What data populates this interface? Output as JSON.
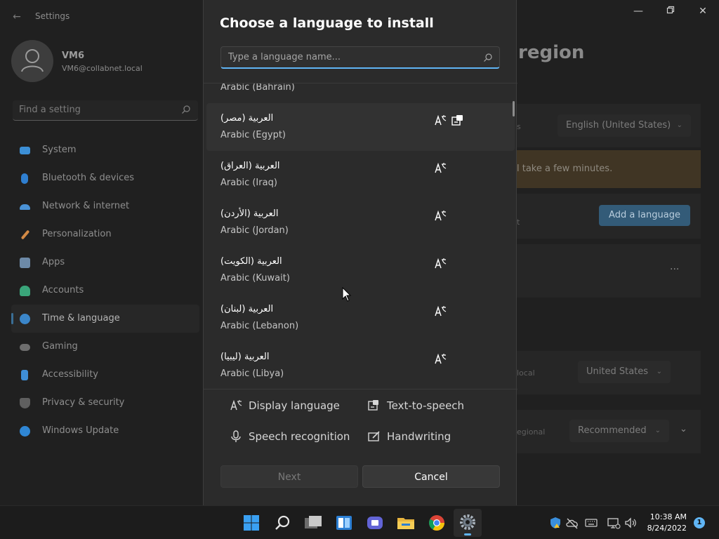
{
  "settings_window": {
    "app_title": "Settings",
    "user": {
      "name": "VM6",
      "email": "VM6@collabnet.local"
    },
    "search_placeholder": "Find a setting",
    "nav_items": [
      {
        "label": "System",
        "icon": "monitor-icon",
        "color": "#3c8fd6"
      },
      {
        "label": "Bluetooth & devices",
        "icon": "bluetooth-icon",
        "color": "#2f7fd0"
      },
      {
        "label": "Network & internet",
        "icon": "wifi-icon",
        "color": "#4a92d6"
      },
      {
        "label": "Personalization",
        "icon": "brush-icon",
        "color": "#d38a45"
      },
      {
        "label": "Apps",
        "icon": "apps-icon",
        "color": "#6d8aa8"
      },
      {
        "label": "Accounts",
        "icon": "person-icon",
        "color": "#3aa57a"
      },
      {
        "label": "Time & language",
        "icon": "globe-clock-icon",
        "color": "#3b86c9"
      },
      {
        "label": "Gaming",
        "icon": "gamepad-icon",
        "color": "#8a8a8a"
      },
      {
        "label": "Accessibility",
        "icon": "accessibility-icon",
        "color": "#3f8fd8"
      },
      {
        "label": "Privacy & security",
        "icon": "shield-icon",
        "color": "#6f6f6f"
      },
      {
        "label": "Windows Update",
        "icon": "update-icon",
        "color": "#2f86d4"
      }
    ],
    "active_nav": "Time & language",
    "page_header_partial": "region",
    "windows_display_language": "English (United States)",
    "notice_partial": "l take a few minutes.",
    "add_language_button": "Add a language",
    "ellipsis": "···",
    "country_label_partial": "local",
    "country_value": "United States",
    "regional_label_partial": "egional",
    "regional_value": "Recommended",
    "status_partial_s": "s",
    "status_partial_t": "t"
  },
  "dialog": {
    "title": "Choose a language to install",
    "search_placeholder": "Type a language name...",
    "languages": [
      {
        "native": "",
        "english": "Arabic (Bahrain)",
        "display_language": false,
        "tts": false
      },
      {
        "native": "العربية (مصر)",
        "english": "Arabic (Egypt)",
        "display_language": true,
        "tts": true
      },
      {
        "native": "العربية (العراق)",
        "english": "Arabic (Iraq)",
        "display_language": true,
        "tts": false
      },
      {
        "native": "العربية (الأردن)",
        "english": "Arabic (Jordan)",
        "display_language": true,
        "tts": false
      },
      {
        "native": "العربية (الكويت)",
        "english": "Arabic (Kuwait)",
        "display_language": true,
        "tts": false
      },
      {
        "native": "العربية (لبنان)",
        "english": "Arabic (Lebanon)",
        "display_language": true,
        "tts": false
      },
      {
        "native": "العربية (ليبيا)",
        "english": "Arabic (Libya)",
        "display_language": true,
        "tts": false
      }
    ],
    "hovered_language": "Arabic (Egypt)",
    "legend": {
      "display_language": "Display language",
      "text_to_speech": "Text-to-speech",
      "speech_recognition": "Speech recognition",
      "handwriting": "Handwriting"
    },
    "next_button": "Next",
    "cancel_button": "Cancel"
  },
  "taskbar": {
    "apps": [
      "start-icon",
      "search-icon",
      "task-view-icon",
      "widgets-icon",
      "teams-chat-icon",
      "file-explorer-icon",
      "chrome-icon",
      "settings-icon"
    ],
    "active_app": "settings-icon",
    "clock_time": "10:38 AM",
    "clock_date": "8/24/2022",
    "notification_count": "1"
  },
  "colors": {
    "accent": "#60b5f5",
    "dialog_bg": "#2b2b2b",
    "settings_bg": "#202020",
    "taskbar_bg": "#1c1c1c"
  }
}
